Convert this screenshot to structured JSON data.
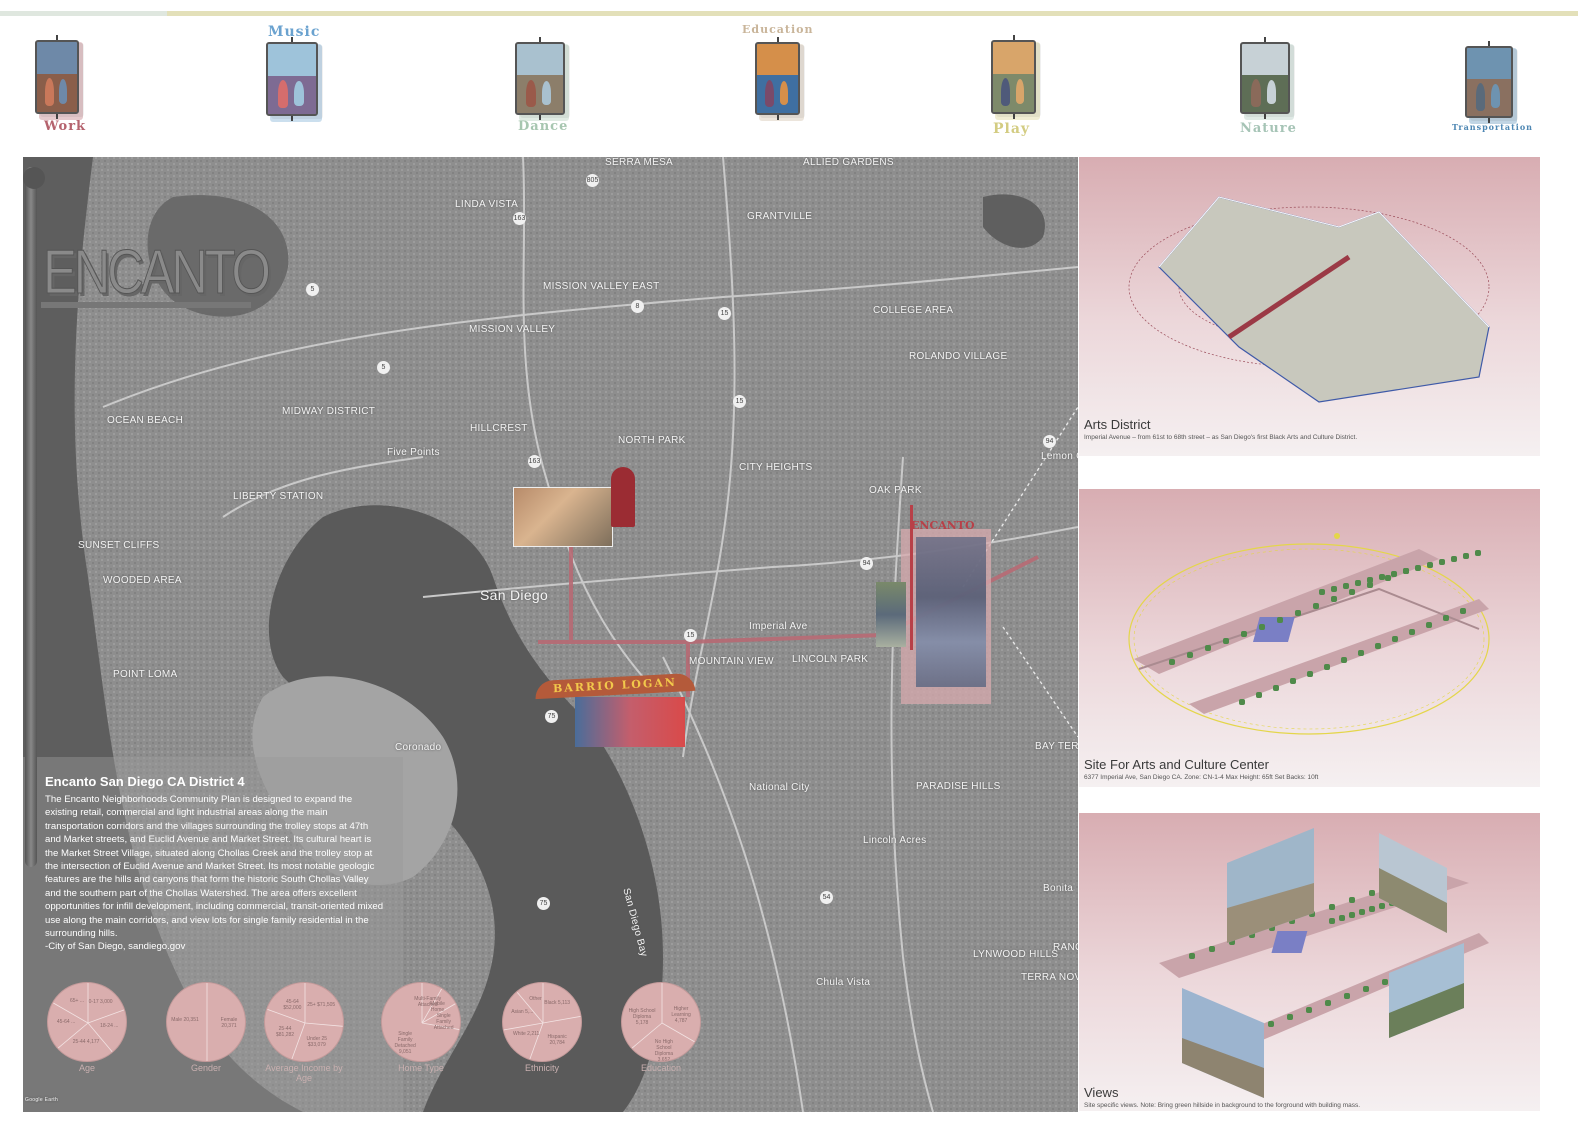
{
  "banners": [
    {
      "label": "Work",
      "color": "#b5636e"
    },
    {
      "label": "Music",
      "color": "#6aa2cf"
    },
    {
      "label": "Dance",
      "color": "#a7c6b0"
    },
    {
      "label": "Education",
      "color": "#c9b59a"
    },
    {
      "label": "Play",
      "color": "#d3cc82"
    },
    {
      "label": "Nature",
      "color": "#a6c4b6"
    },
    {
      "label": "Transportation",
      "color": "#4e87b3"
    }
  ],
  "map": {
    "logo": "ENCANTO",
    "places": [
      "SERRA MESA",
      "ALLIED GARDENS",
      "LINDA VISTA",
      "GRANTVILLE",
      "MISSION VALLEY EAST",
      "MISSION VALLEY",
      "COLLEGE AREA",
      "ROLANDO VILLAGE",
      "OCEAN BEACH",
      "MIDWAY DISTRICT",
      "HILLCREST",
      "NORTH PARK",
      "Five Points",
      "CITY HEIGHTS",
      "OAK PARK",
      "Lemon Grove",
      "LIBERTY STATION",
      "SUNSET CLIFFS",
      "WOODED AREA",
      "San Diego",
      "Imperial Ave",
      "MOUNTAIN VIEW",
      "LINCOLN PARK",
      "POINT LOMA",
      "Coronado",
      "BAY TERRACES",
      "National City",
      "PARADISE HILLS",
      "Lincoln Acres",
      "San Diego Bay",
      "Bonita",
      "LYNWOOD HILLS",
      "TERRA NOVA",
      "Chula Vista",
      "RANC"
    ],
    "highways": [
      "163",
      "163",
      "15",
      "15",
      "15",
      "8",
      "94",
      "94",
      "75",
      "75",
      "54",
      "5",
      "5",
      "805"
    ],
    "barrio_sign": "BARRIO LOGAN",
    "encanto_sign": "ENCANTO",
    "watermark": "Google Earth"
  },
  "description": {
    "title": "Encanto San Diego CA District 4",
    "body": "The Encanto Neighborhoods Community Plan is designed to expand the existing retail, commercial and light industrial areas along the main transportation corridors and the villages surrounding the trolley stops at 47th and Market streets, and Euclid Avenue and Market Street. Its cultural heart is the Market Street Village, situated along Chollas Creek and the trolley stop at the intersection of Euclid Avenue and Market Street. Its most notable geologic features are the hills and canyons that form the historic South Chollas Valley and the southern part of the Chollas Watershed. The area offers excellent opportunities for infill development, including commercial, transit-oriented mixed use along the main corridors, and view lots for single family residential in the surrounding hills.",
    "source": "-City of San Diego, sandiego.gov"
  },
  "pies": [
    {
      "label": "Age",
      "slices": [
        "0-17 3,000",
        "18-24 ...",
        "25-44 4,177",
        "45-64 ...",
        "65+ ..."
      ]
    },
    {
      "label": "Gender",
      "slices": [
        "Female 20,371",
        "Male 20,351"
      ]
    },
    {
      "label": "Average Income by Age",
      "slices": [
        "25+ $71,505",
        "Under 25 $33,079",
        "25-44 $81,282",
        "45-64 $52,000"
      ]
    },
    {
      "label": "Home Type",
      "slices": [
        "Multi-Family Attached",
        "Mobile Home",
        "Single Family Attached",
        "Single Family Detached 9,051"
      ]
    },
    {
      "label": "Ethnicity",
      "slices": [
        "Black 5,113",
        "Hispanic 20,784",
        "White 2,211",
        "Asian 5,...",
        "Other"
      ]
    },
    {
      "label": "Education",
      "slices": [
        "Higher Learning 4,787",
        "No High School Diploma 3,652",
        "High School Diploma 5,178"
      ]
    }
  ],
  "panels": [
    {
      "title": "Arts District",
      "note": "Imperial Avenue – from 61st to 68th street – as San Diego's first Black Arts and Culture District."
    },
    {
      "title": "Site For Arts and Culture Center",
      "note": "6377 Imperial    Ave, San Diego CA. Zone: CN-1-4 Max Height: 65ft Set Backs: 10ft"
    },
    {
      "title": "Views",
      "note": "Site specific views. Note: Bring green hillside in background to the forground with building mass."
    }
  ],
  "colors": {
    "accent": "#b86a74",
    "panel": "#d8adb2",
    "map": "#8f8f8f"
  }
}
